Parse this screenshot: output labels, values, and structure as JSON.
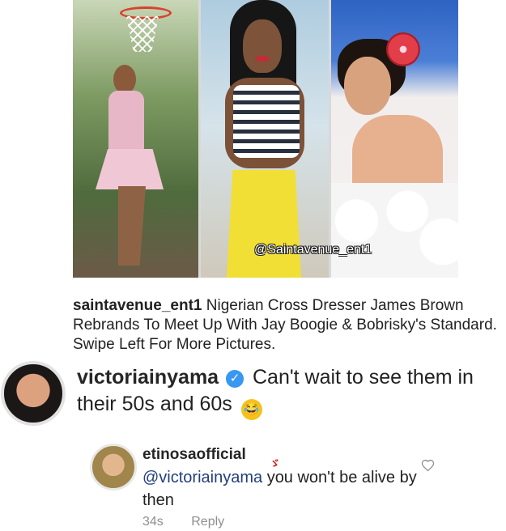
{
  "post": {
    "watermark": "@Saintavenue_ent1",
    "caption_username": "saintavenue_ent1",
    "caption_text": "Nigerian Cross Dresser James Brown Rebrands To Meet Up With Jay Boogie & Bobrisky's Standard. Swipe Left For More Pictures."
  },
  "comment": {
    "username": "victoriainyama",
    "verified_icon": "verified-check-icon",
    "text": "Can't wait to see them in their 50s and 60s",
    "emoji_icon": "laughing-emoji-icon"
  },
  "reply": {
    "username": "etinosaofficial",
    "mention": "@victoriainyama",
    "text": "you won't be alive by then",
    "time": "34s",
    "reply_label": "Reply",
    "heart_icon": "heart-outline-icon"
  }
}
